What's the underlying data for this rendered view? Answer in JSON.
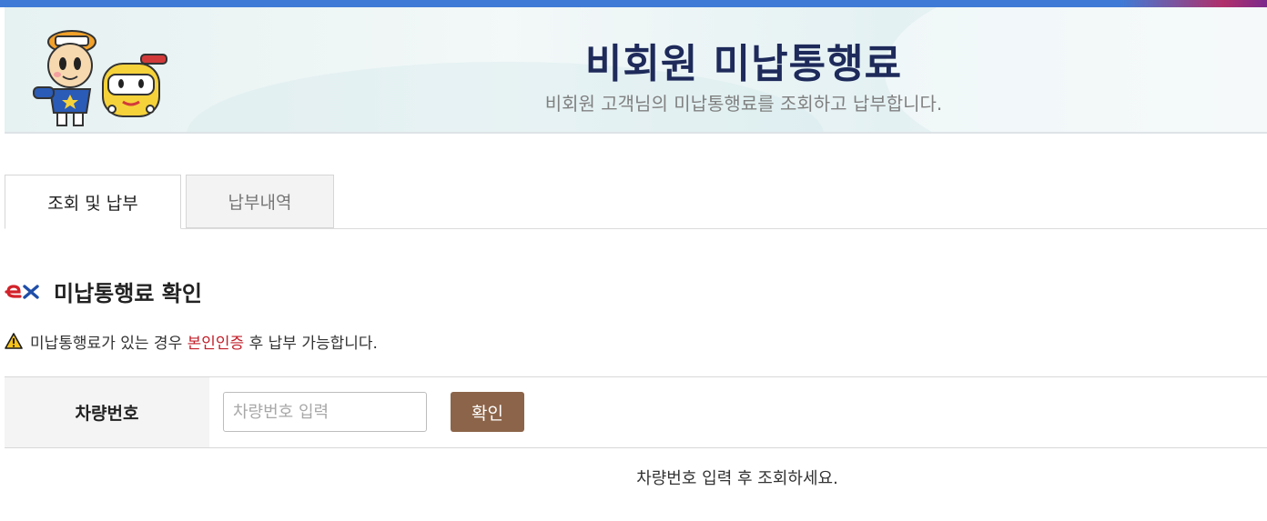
{
  "header": {
    "title": "비회원 미납통행료",
    "subtitle": "비회원 고객님의 미납통행료를 조회하고 납부합니다.",
    "mascot_icon": "mascot-characters"
  },
  "tabs": [
    {
      "label": "조회 및 납부",
      "active": true
    },
    {
      "label": "납부내역",
      "active": false
    }
  ],
  "section": {
    "icon": "ex-logo-icon",
    "title": "미납통행료 확인"
  },
  "notice": {
    "icon": "warning-icon",
    "prefix": "미납통행료가 있는 경우 ",
    "highlight": "본인인증",
    "suffix": " 후 납부 가능합니다."
  },
  "form": {
    "label": "차량번호",
    "input_value": "",
    "input_placeholder": "차량번호 입력",
    "button_label": "확인"
  },
  "result": {
    "message": "차량번호 입력 후 조회하세요."
  },
  "colors": {
    "topbar": "#3f7bd6",
    "title": "#1e2a5a",
    "button": "#8c6449",
    "highlight": "#c21f2a"
  }
}
